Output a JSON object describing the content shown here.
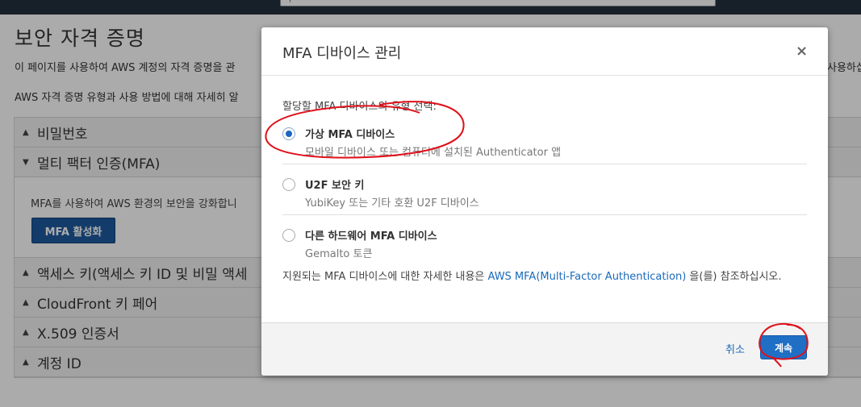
{
  "topbar": {
    "search_icon": "search-icon"
  },
  "page": {
    "title": "보안 자격 증명",
    "intro_line1": "이 페이지를 사용하여 AWS 계정의 자격 증명을 관",
    "intro_line1_right": "사용하십",
    "intro_line2": "AWS 자격 증명 유형과 사용 방법에 대해 자세히 알"
  },
  "accordion": {
    "items": [
      {
        "label": "비밀번호",
        "expanded": false
      },
      {
        "label": "멀티 팩터 인증(MFA)",
        "expanded": true
      },
      {
        "label": "액세스 키(액세스 키 ID 및 비밀 액세",
        "expanded": false
      },
      {
        "label": "CloudFront 키 페어",
        "expanded": false
      },
      {
        "label": "X.509 인증서",
        "expanded": false
      },
      {
        "label": "계정 ID",
        "expanded": false
      }
    ],
    "mfa_desc": "MFA를 사용하여 AWS 환경의 보안을 강화합니",
    "mfa_button": "MFA 활성화"
  },
  "modal": {
    "title": "MFA 디바이스 관리",
    "close_icon": "×",
    "type_label": "할당할 MFA 디바이스의 유형 선택:",
    "options": [
      {
        "title": "가상 MFA 디바이스",
        "desc": "모바일 디바이스 또는 컴퓨터에 설치된 Authenticator 앱",
        "selected": true
      },
      {
        "title": "U2F 보안 키",
        "desc": "YubiKey 또는 기타 호환 U2F 디바이스",
        "selected": false
      },
      {
        "title": "다른 하드웨어 MFA 디바이스",
        "desc": "Gemalto 토큰",
        "selected": false
      }
    ],
    "info_prefix": "지원되는 MFA 디바이스에 대한 자세한 내용은 ",
    "info_link": "AWS MFA(Multi-Factor Authentication)",
    "info_suffix": " 을(를) 참조하십시오.",
    "cancel_label": "취소",
    "continue_label": "계속"
  },
  "colors": {
    "navbar": "#232f3e",
    "primary_button": "#1f6fc5",
    "link": "#1a6aba",
    "annotation": "#e0101a"
  }
}
